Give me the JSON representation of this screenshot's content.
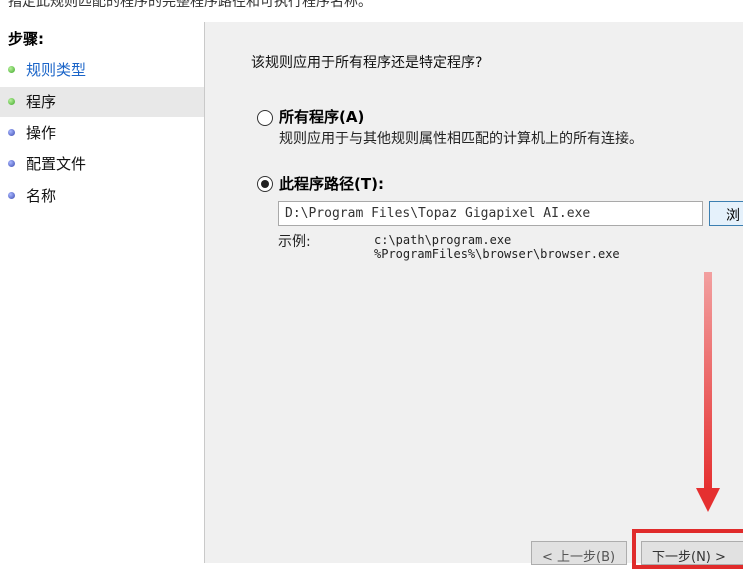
{
  "top_hint": "指定此规则匹配的程序的完整程序路径和可执行程序名称。",
  "sidebar": {
    "title": "步骤:",
    "items": [
      {
        "label": "规则类型",
        "bullet": "green",
        "link": true
      },
      {
        "label": "程序",
        "bullet": "green",
        "active": true
      },
      {
        "label": "操作",
        "bullet": "blue"
      },
      {
        "label": "配置文件",
        "bullet": "blue"
      },
      {
        "label": "名称",
        "bullet": "blue"
      }
    ]
  },
  "main": {
    "question": "该规则应用于所有程序还是特定程序?",
    "all_programs": {
      "label": "所有程序(A)",
      "description": "规则应用于与其他规则属性相匹配的计算机上的所有连接。",
      "selected": false
    },
    "this_program": {
      "label": "此程序路径(T):",
      "selected": true,
      "path_value": "D:\\Program Files\\Topaz Gigapixel AI.exe",
      "browse_label": "浏"
    },
    "example": {
      "label": "示例:",
      "lines": [
        "c:\\path\\program.exe",
        "%ProgramFiles%\\browser\\browser.exe"
      ]
    }
  },
  "footer": {
    "back_label": "< 上一步(B)",
    "next_label": "下一步(N) >"
  },
  "colors": {
    "accent_link": "#1a64c8",
    "highlight": "#e02b2b",
    "panel_bg": "#f0f0f0"
  }
}
